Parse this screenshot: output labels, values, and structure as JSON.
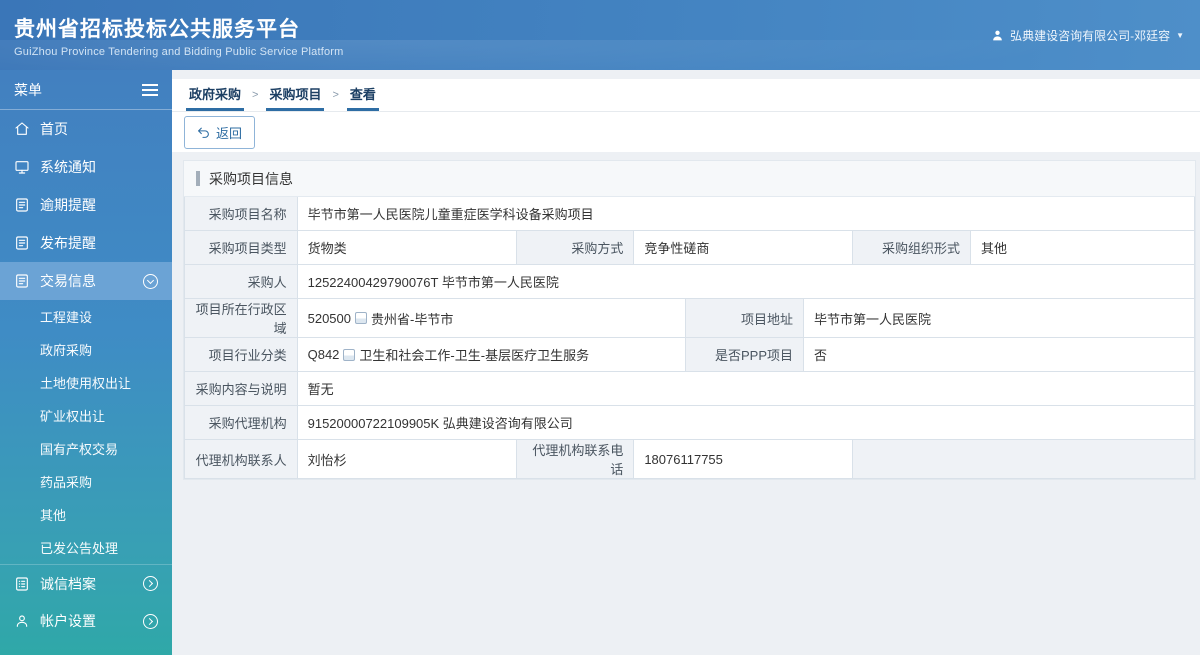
{
  "header": {
    "title": "贵州省招标投标公共服务平台",
    "subtitle": "GuiZhou Province Tendering and Bidding Public Service Platform",
    "user_label": "弘典建设咨询有限公司-邓廷容",
    "caret": "▼"
  },
  "sidebar": {
    "menu_title": "菜单",
    "items": [
      {
        "label": "首页"
      },
      {
        "label": "系统通知"
      },
      {
        "label": "逾期提醒"
      },
      {
        "label": "发布提醒"
      },
      {
        "label": "交易信息"
      },
      {
        "label": "诚信档案"
      },
      {
        "label": "帐户设置"
      }
    ],
    "submenu": [
      "工程建设",
      "政府采购",
      "土地使用权出让",
      "矿业权出让",
      "国有产权交易",
      "药品采购",
      "其他",
      "已发公告处理"
    ]
  },
  "breadcrumb": {
    "items": [
      "政府采购",
      "采购项目",
      "查看"
    ],
    "separator": ">"
  },
  "toolbar": {
    "back_label": "返回"
  },
  "form": {
    "title": "采购项目信息",
    "row1": {
      "label": "采购项目名称",
      "value": "毕节市第一人民医院儿童重症医学科设备采购项目"
    },
    "row2": {
      "l1": "采购项目类型",
      "v1": "货物类",
      "l2": "采购方式",
      "v2": "竞争性磋商",
      "l3": "采购组织形式",
      "v3": "其他"
    },
    "row3": {
      "label": "采购人",
      "value": "12522400429790076T 毕节市第一人民医院"
    },
    "row4": {
      "l1": "项目所在行政区域",
      "code": "520500",
      "region": "贵州省-毕节市",
      "l2": "项目地址",
      "v2": "毕节市第一人民医院"
    },
    "row5": {
      "l1": "项目行业分类",
      "code": "Q842",
      "industry": "卫生和社会工作-卫生-基层医疗卫生服务",
      "l2": "是否PPP项目",
      "v2": "否"
    },
    "row6": {
      "label": "采购内容与说明",
      "value": "暂无"
    },
    "row7": {
      "label": "采购代理机构",
      "value": "91520000722109905K 弘典建设咨询有限公司"
    },
    "row8": {
      "l1": "代理机构联系人",
      "v1": "刘怡杉",
      "l2": "代理机构联系电话",
      "v2": "18076117755"
    }
  },
  "icons": {
    "header_user": "user-icon",
    "menu_toggle": "hamburger-icon",
    "back": "back-arrow-icon",
    "expanded_marker": "chevron-down-circle-icon",
    "collapsed_marker": "chevron-right-circle-icon"
  },
  "colors": {
    "header_blue": "#3b77b7",
    "sidebar_teal": "#2fa8a8",
    "active_menu": "#6ba3d5",
    "breadcrumb_accent": "#2e6da4",
    "label_cell_bg": "#eff2f6",
    "table_border": "#d9e1e9"
  }
}
